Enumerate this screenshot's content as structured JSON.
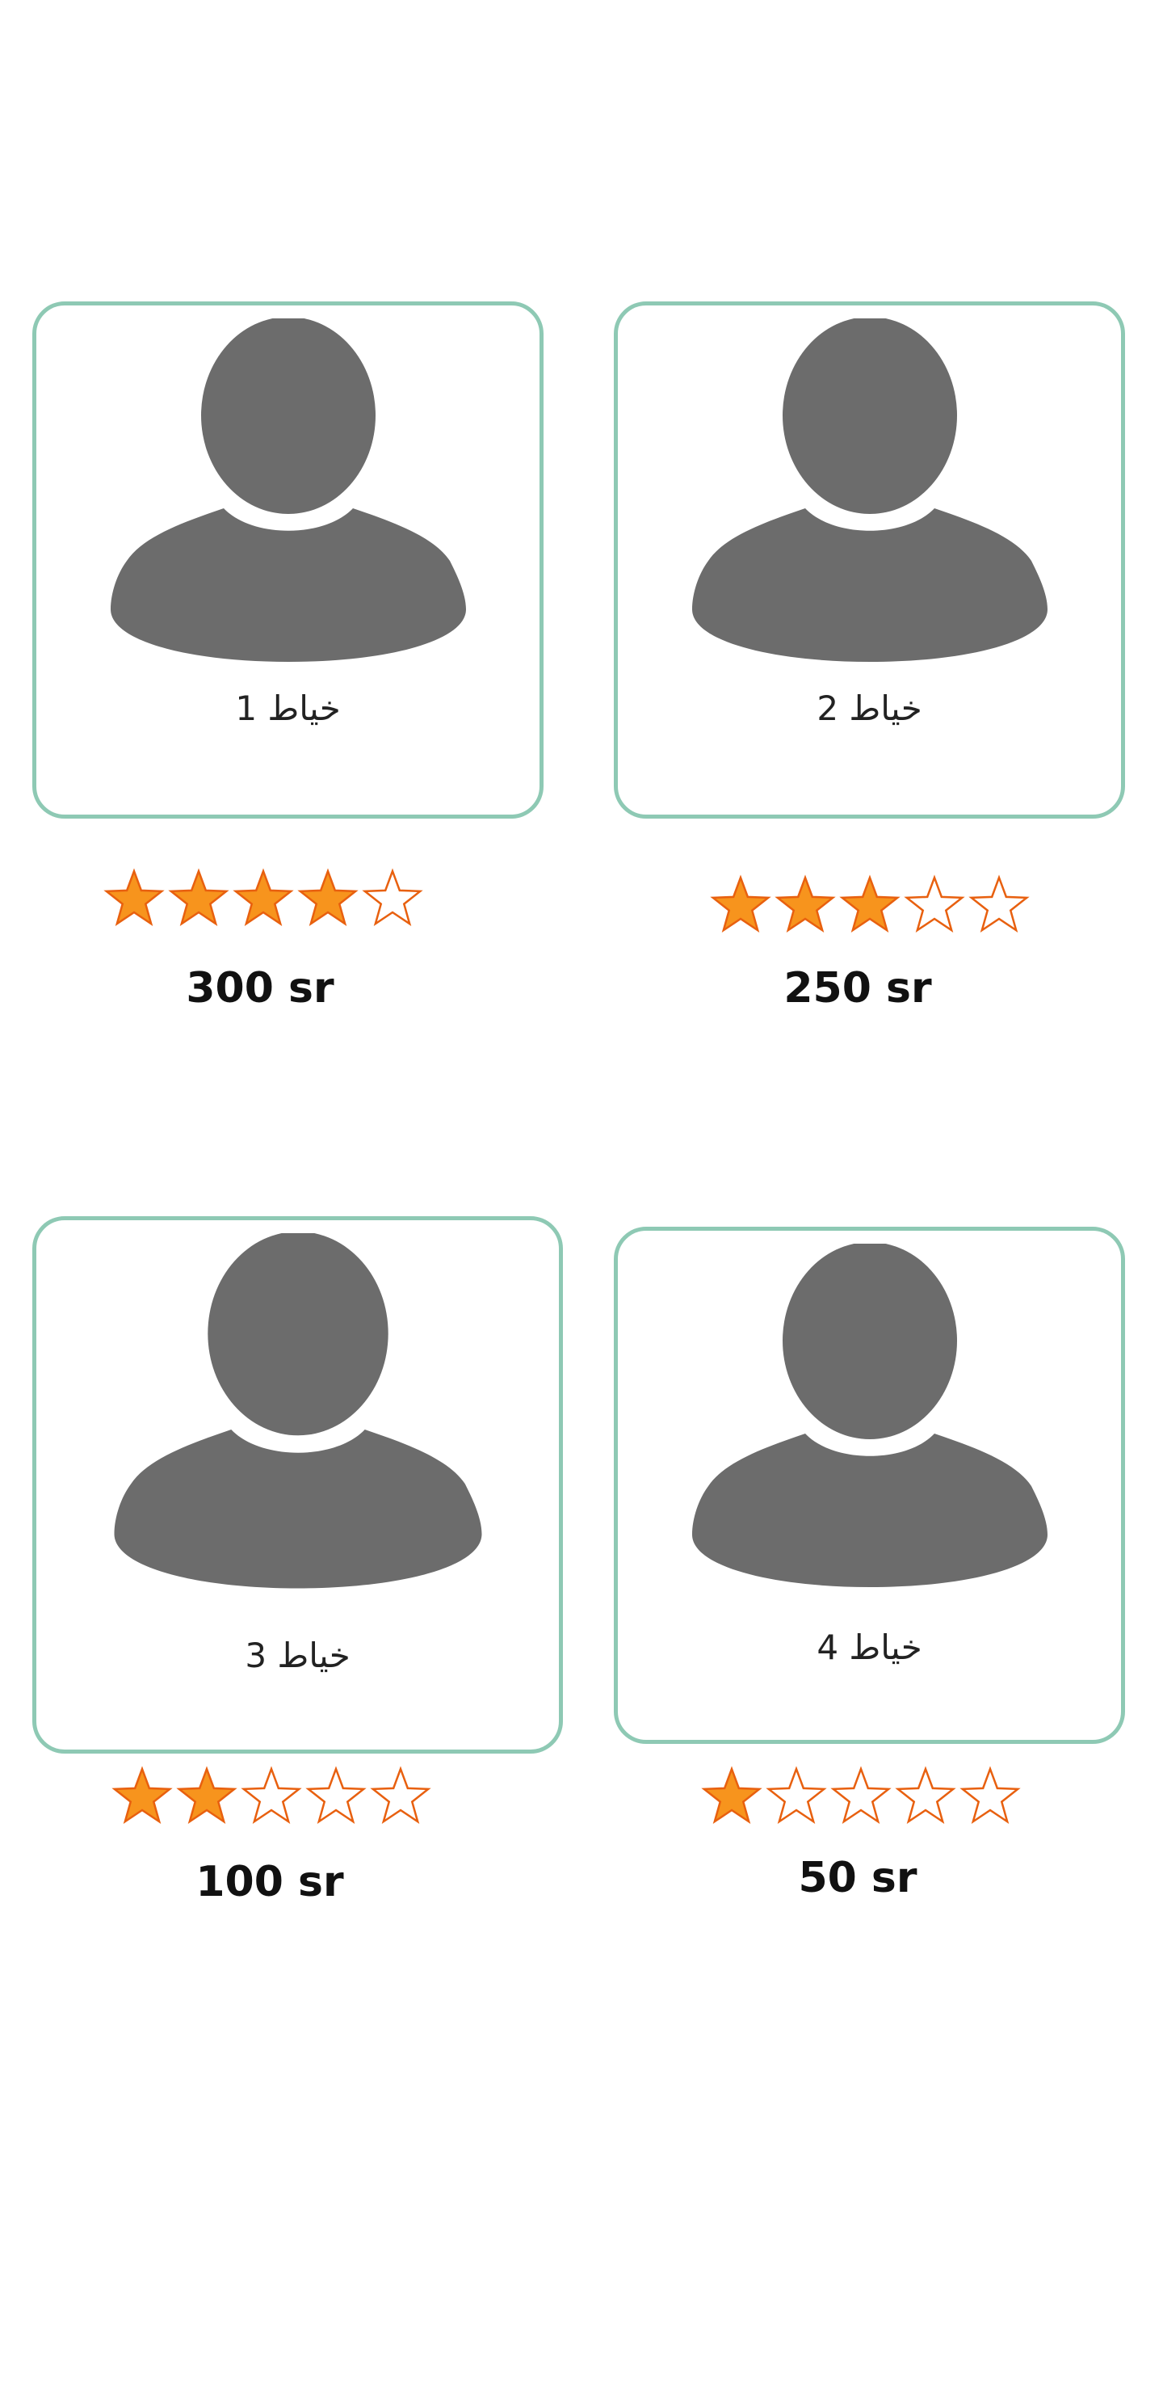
{
  "colors": {
    "card_border": "#8ec9b4",
    "avatar_fill": "#6c6c6c",
    "star_fill": "#f7941d",
    "star_outline": "#e8600f"
  },
  "tailors": [
    {
      "name": "خياط 1",
      "rating": 4,
      "max_rating": 5,
      "price": "300 sr",
      "icon": "person-silhouette-icon"
    },
    {
      "name": "خياط 2",
      "rating": 3,
      "max_rating": 5,
      "price": "250 sr",
      "icon": "person-silhouette-icon"
    },
    {
      "name": "خياط 3",
      "rating": 2,
      "max_rating": 5,
      "price": "100 sr",
      "icon": "person-silhouette-icon"
    },
    {
      "name": "خياط 4",
      "rating": 1,
      "max_rating": 5,
      "price": "50 sr",
      "icon": "person-silhouette-icon"
    }
  ]
}
